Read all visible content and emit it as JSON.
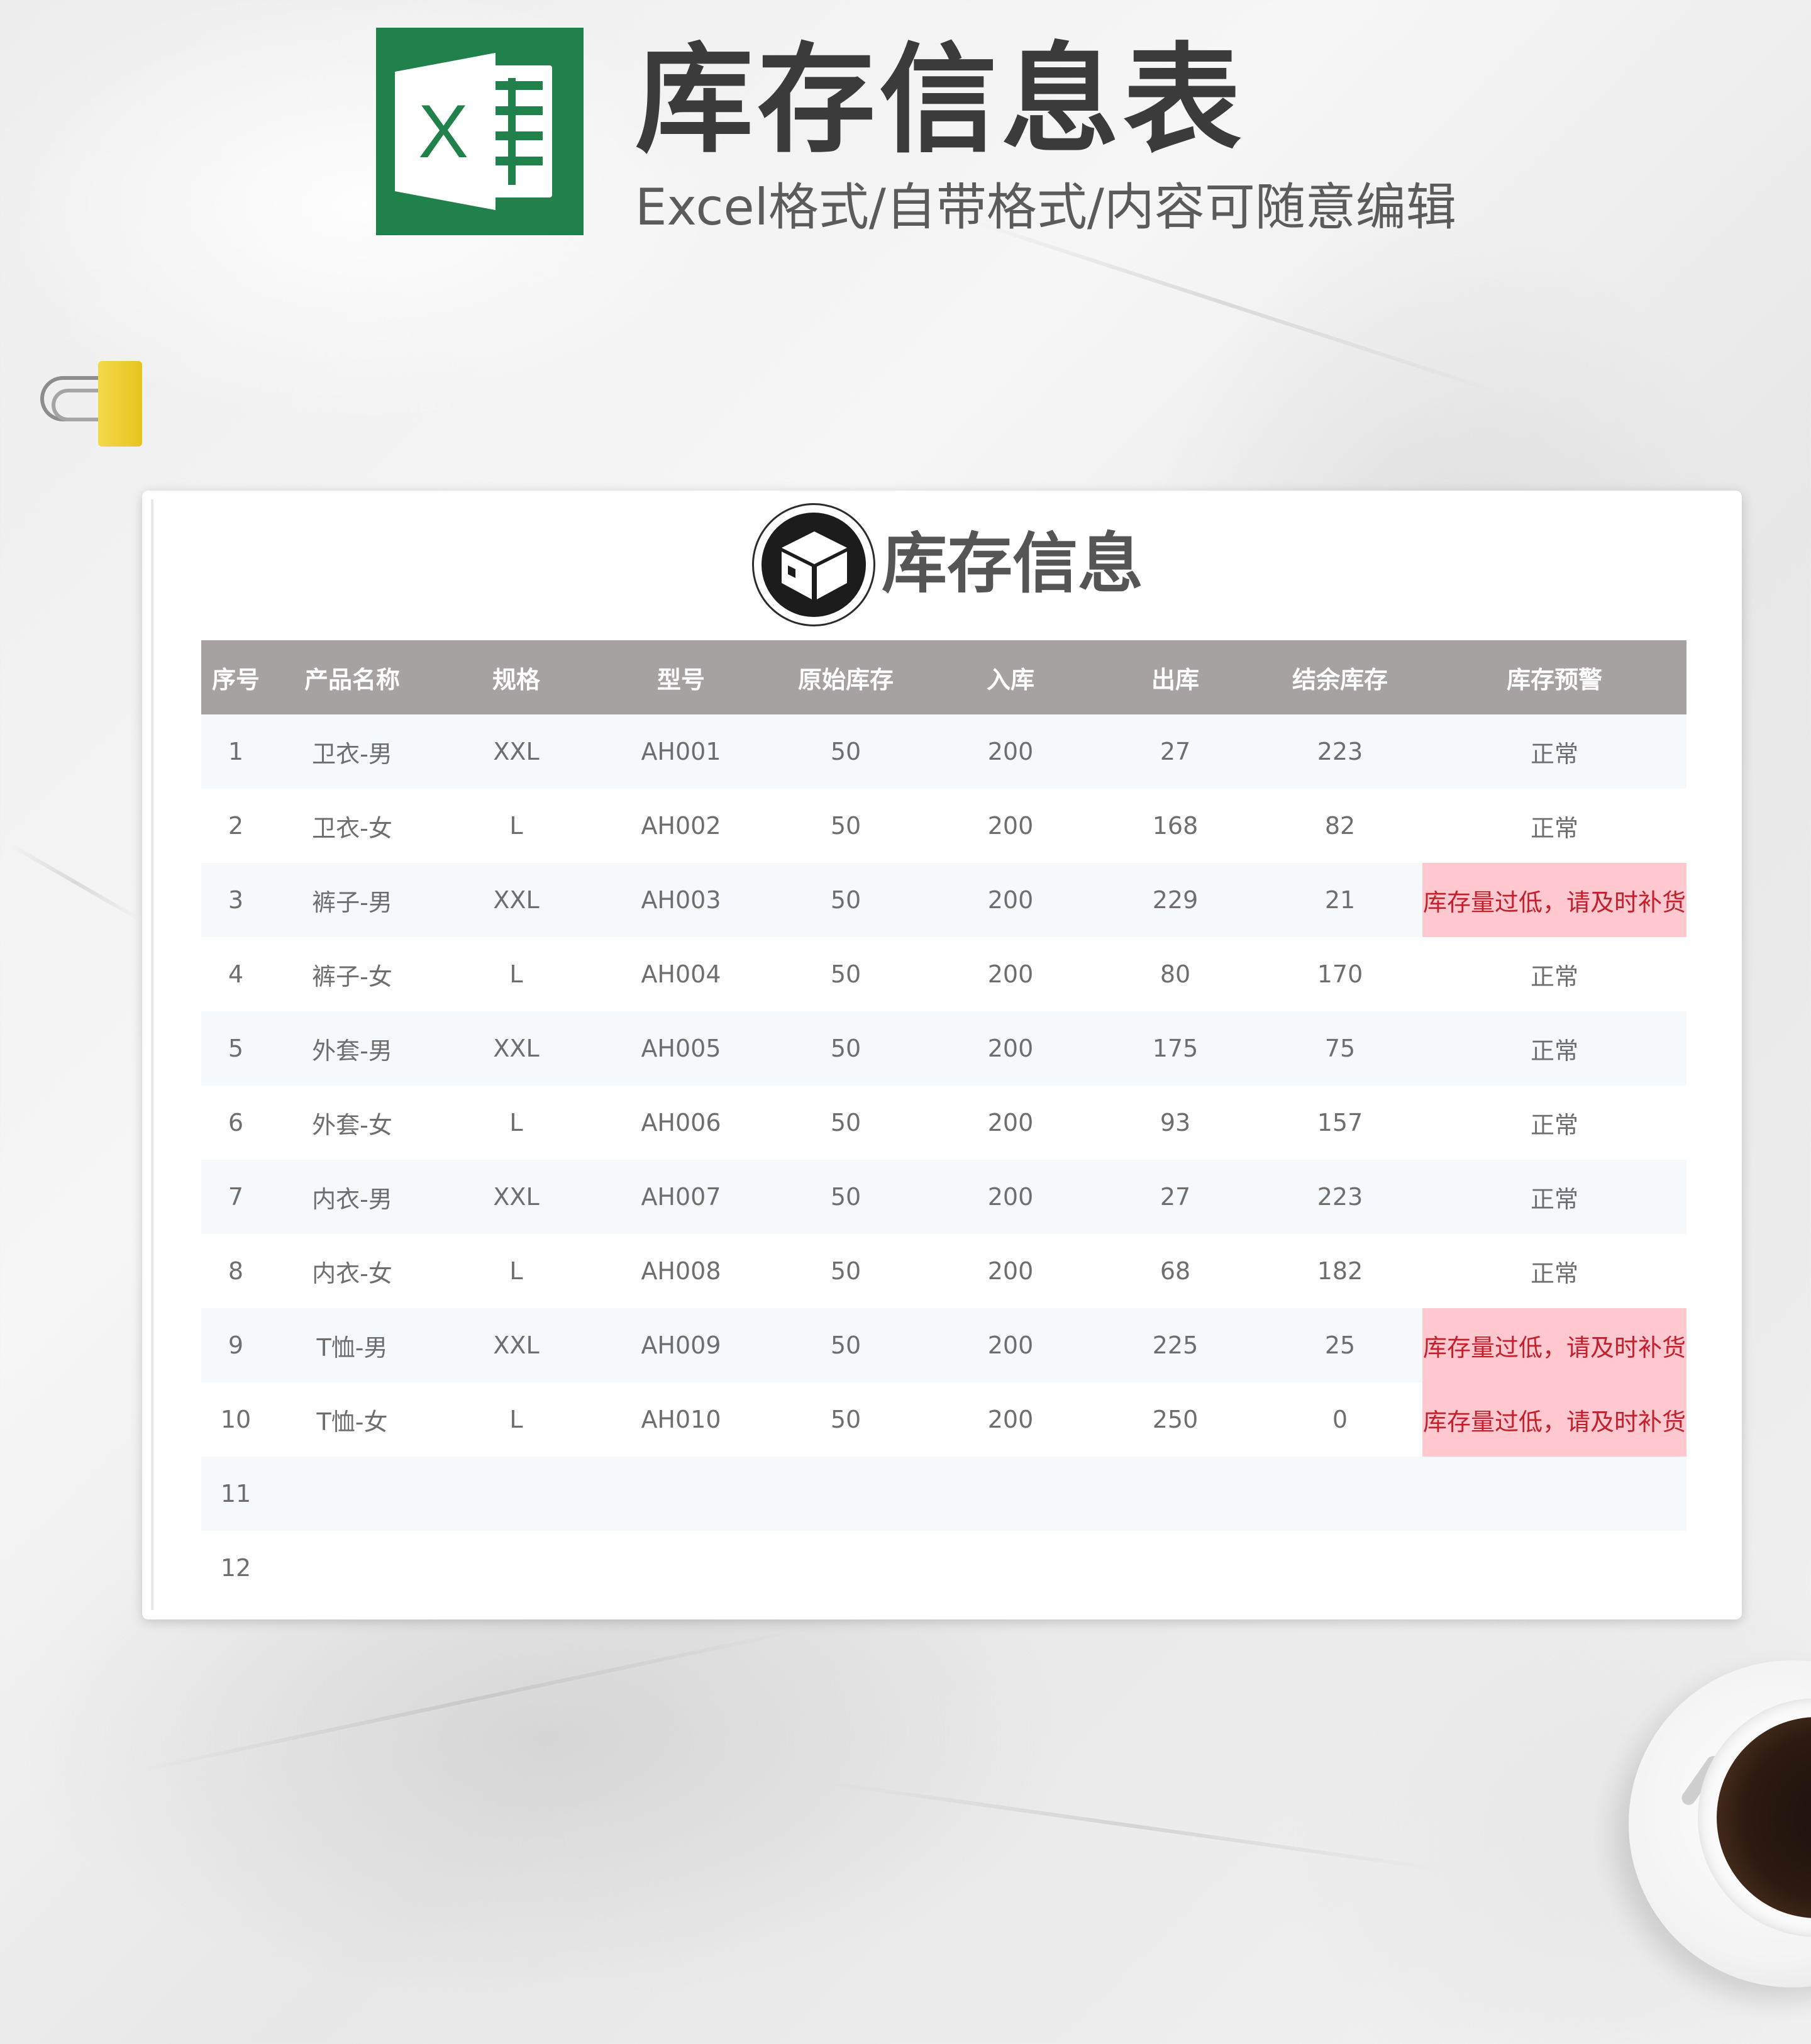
{
  "header": {
    "logo_letter": "X",
    "title": "库存信息表",
    "subtitle": "Excel格式/自带格式/内容可随意编辑"
  },
  "card": {
    "title": "库存信息",
    "icon": "package-box-icon"
  },
  "table": {
    "columns": [
      "序号",
      "产品名称",
      "规格",
      "型号",
      "原始库存",
      "入库",
      "出库",
      "结余库存",
      "库存预警"
    ],
    "rows": [
      {
        "no": "1",
        "name": "卫衣-男",
        "spec": "XXL",
        "model": "AH001",
        "initial": "50",
        "in": "200",
        "out": "27",
        "balance": "223",
        "alert": "正常",
        "low": false
      },
      {
        "no": "2",
        "name": "卫衣-女",
        "spec": "L",
        "model": "AH002",
        "initial": "50",
        "in": "200",
        "out": "168",
        "balance": "82",
        "alert": "正常",
        "low": false
      },
      {
        "no": "3",
        "name": "裤子-男",
        "spec": "XXL",
        "model": "AH003",
        "initial": "50",
        "in": "200",
        "out": "229",
        "balance": "21",
        "alert": "库存量过低，请及时补货",
        "low": true
      },
      {
        "no": "4",
        "name": "裤子-女",
        "spec": "L",
        "model": "AH004",
        "initial": "50",
        "in": "200",
        "out": "80",
        "balance": "170",
        "alert": "正常",
        "low": false
      },
      {
        "no": "5",
        "name": "外套-男",
        "spec": "XXL",
        "model": "AH005",
        "initial": "50",
        "in": "200",
        "out": "175",
        "balance": "75",
        "alert": "正常",
        "low": false
      },
      {
        "no": "6",
        "name": "外套-女",
        "spec": "L",
        "model": "AH006",
        "initial": "50",
        "in": "200",
        "out": "93",
        "balance": "157",
        "alert": "正常",
        "low": false
      },
      {
        "no": "7",
        "name": "内衣-男",
        "spec": "XXL",
        "model": "AH007",
        "initial": "50",
        "in": "200",
        "out": "27",
        "balance": "223",
        "alert": "正常",
        "low": false
      },
      {
        "no": "8",
        "name": "内衣-女",
        "spec": "L",
        "model": "AH008",
        "initial": "50",
        "in": "200",
        "out": "68",
        "balance": "182",
        "alert": "正常",
        "low": false
      },
      {
        "no": "9",
        "name": "T恤-男",
        "spec": "XXL",
        "model": "AH009",
        "initial": "50",
        "in": "200",
        "out": "225",
        "balance": "25",
        "alert": "库存量过低，请及时补货",
        "low": true
      },
      {
        "no": "10",
        "name": "T恤-女",
        "spec": "L",
        "model": "AH010",
        "initial": "50",
        "in": "200",
        "out": "250",
        "balance": "0",
        "alert": "库存量过低，请及时补货",
        "low": true
      },
      {
        "no": "11",
        "name": "",
        "spec": "",
        "model": "",
        "initial": "",
        "in": "",
        "out": "",
        "balance": "",
        "alert": "",
        "low": false
      },
      {
        "no": "12",
        "name": "",
        "spec": "",
        "model": "",
        "initial": "",
        "in": "",
        "out": "",
        "balance": "",
        "alert": "",
        "low": false
      }
    ]
  },
  "colors": {
    "excel_green": "#20824a",
    "header_bg": "#a7a2a2",
    "row_alt_bg": "#f6f9fc",
    "warning_bg": "#ffc9cf",
    "warning_text": "#c3202e"
  }
}
